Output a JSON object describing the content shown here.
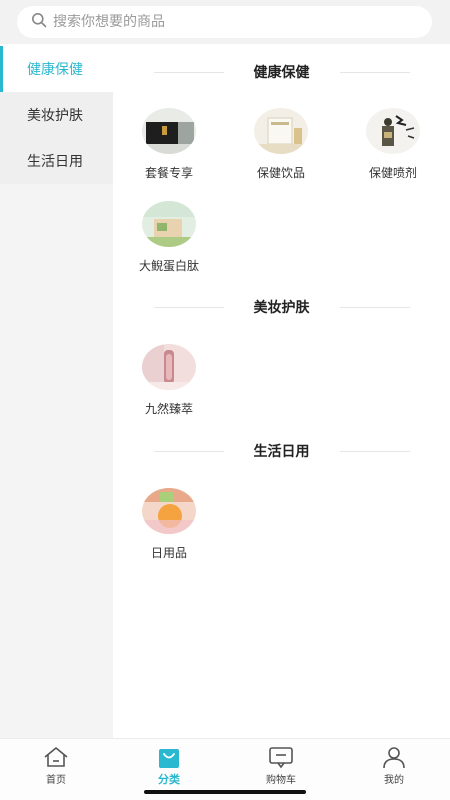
{
  "search": {
    "placeholder": "搜索你想要的商品"
  },
  "sidebar": {
    "items": [
      {
        "label": "健康保健",
        "active": true
      },
      {
        "label": "美妆护肤",
        "active": false
      },
      {
        "label": "生活日用",
        "active": false
      }
    ]
  },
  "sections": [
    {
      "title": "健康保健",
      "items": [
        {
          "label": "套餐专享"
        },
        {
          "label": "保健饮品"
        },
        {
          "label": "保健喷剂"
        },
        {
          "label": "大鲵蛋白肽"
        }
      ]
    },
    {
      "title": "美妆护肤",
      "items": [
        {
          "label": "九然臻萃"
        }
      ]
    },
    {
      "title": "生活日用",
      "items": [
        {
          "label": "日用品"
        }
      ]
    }
  ],
  "tabbar": {
    "tabs": [
      {
        "label": "首页",
        "icon": "home-icon",
        "active": false
      },
      {
        "label": "分类",
        "icon": "category-bag-icon",
        "active": true
      },
      {
        "label": "购物车",
        "icon": "cart-message-icon",
        "active": false
      },
      {
        "label": "我的",
        "icon": "user-icon",
        "active": false
      }
    ]
  },
  "colors": {
    "accent": "#2ab8d0",
    "sidebar_bg": "#f4f4f4",
    "text": "#333333"
  }
}
